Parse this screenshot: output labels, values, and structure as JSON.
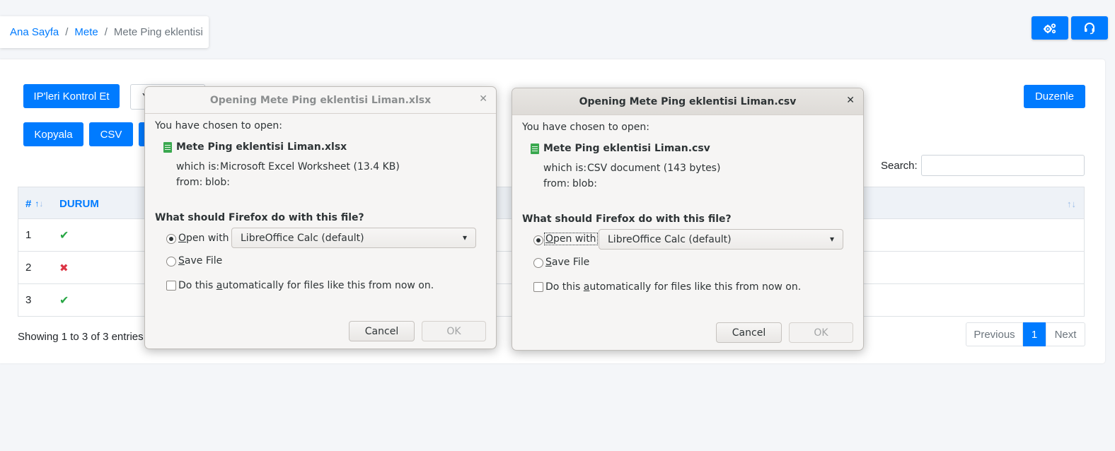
{
  "breadcrumb": {
    "home": "Ana Sayfa",
    "parent": "Mete",
    "current": "Mete Ping eklentisi"
  },
  "top_buttons": {
    "settings_icon": "gears-icon",
    "support_icon": "headset-icon"
  },
  "actions": {
    "check_ips": "IP'leri Kontrol Et",
    "dropdown_partial": "Y",
    "edit": "Duzenle",
    "copy": "Kopyala",
    "csv": "CSV"
  },
  "search": {
    "label": "Search:",
    "value": ""
  },
  "table": {
    "columns": [
      "#",
      "DURUM"
    ],
    "rows": [
      {
        "num": "1",
        "status": "ok",
        "glyph": "✔"
      },
      {
        "num": "2",
        "status": "fail",
        "glyph": "✖"
      },
      {
        "num": "3",
        "status": "ok",
        "glyph": "✔"
      }
    ]
  },
  "footer": {
    "info": "Showing 1 to 3 of 3 entries",
    "previous": "Previous",
    "page": "1",
    "next": "Next"
  },
  "dialogs": [
    {
      "title": "Opening Mete Ping eklentisi Liman.xlsx",
      "chosen": "You have chosen to open:",
      "filename": "Mete Ping eklentisi Liman.xlsx",
      "which_label": "which is:",
      "which_value": "Microsoft Excel Worksheet (13.4 KB)",
      "from_label": "from:",
      "from_value": "blob:",
      "question": "What should Firefox do with this file?",
      "open_with_pre": "",
      "open_with_u": "O",
      "open_with_post": "pen with",
      "app": "LibreOffice Calc (default)",
      "save_u": "S",
      "save_post": "ave File",
      "auto_pre": "Do this ",
      "auto_u": "a",
      "auto_post": "utomatically for files like this from now on.",
      "cancel": "Cancel",
      "ok": "OK"
    },
    {
      "title": "Opening Mete Ping eklentisi Liman.csv",
      "chosen": "You have chosen to open:",
      "filename": "Mete Ping eklentisi Liman.csv",
      "which_label": "which is:",
      "which_value": "CSV document (143 bytes)",
      "from_label": "from:",
      "from_value": "blob:",
      "question": "What should Firefox do with this file?",
      "open_with_pre": "",
      "open_with_u": "O",
      "open_with_post": "pen with",
      "app": "LibreOffice Calc (default)",
      "save_u": "S",
      "save_post": "ave File",
      "auto_pre": "Do this ",
      "auto_u": "a",
      "auto_post": "utomatically for files like this from now on.",
      "cancel": "Cancel",
      "ok": "OK"
    }
  ],
  "colors": {
    "primary": "#007bff",
    "success": "#28a745",
    "danger": "#dc3545"
  }
}
